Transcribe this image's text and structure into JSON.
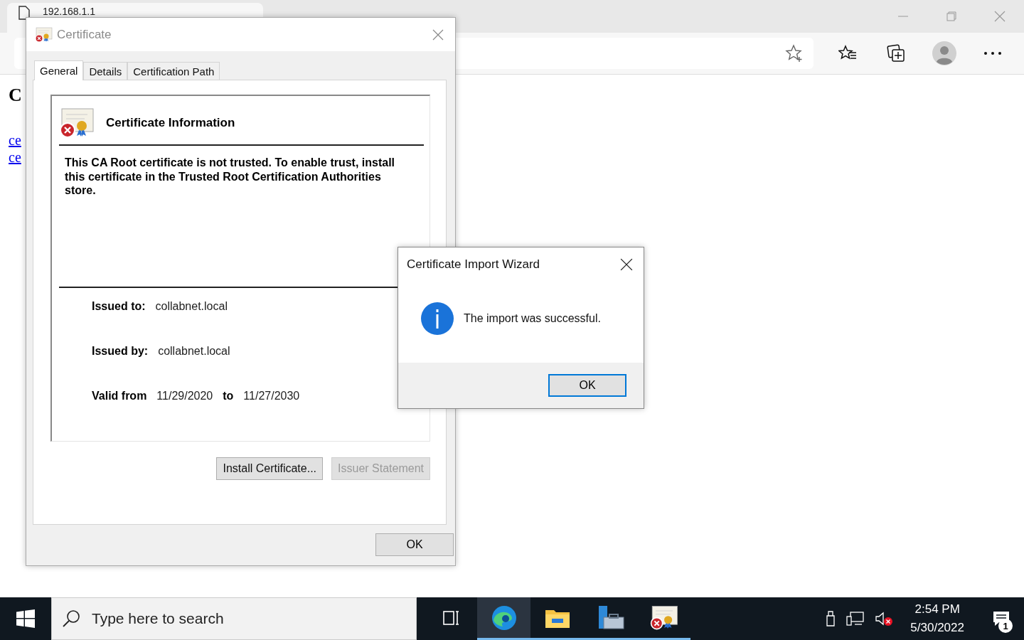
{
  "browser": {
    "tab": {
      "title": "192.168.1.1"
    },
    "page": {
      "heading": "C",
      "links": [
        "ce",
        "ce"
      ]
    }
  },
  "certificate_dialog": {
    "title": "Certificate",
    "tabs": [
      {
        "label": "General",
        "selected": true
      },
      {
        "label": "Details",
        "selected": false
      },
      {
        "label": "Certification Path",
        "selected": false
      }
    ],
    "info_title": "Certificate Information",
    "message": "This CA Root certificate is not trusted. To enable trust, install this certificate in the Trusted Root Certification Authorities store.",
    "fields": [
      {
        "label": "Issued to:",
        "value": "collabnet.local"
      },
      {
        "label": "Issued by:",
        "value": "collabnet.local"
      }
    ],
    "validity": {
      "label": "Valid from",
      "from": "11/29/2020",
      "to_label": "to",
      "to": "11/27/2030"
    },
    "buttons": [
      {
        "label": "Install Certificate...",
        "disabled": false
      },
      {
        "label": "Issuer Statement",
        "disabled": true
      }
    ],
    "ok": "OK"
  },
  "wizard_dialog": {
    "title": "Certificate Import Wizard",
    "message": "The import was successful.",
    "ok": "OK"
  },
  "taskbar": {
    "search_placeholder": "Type here to search",
    "apps": [
      {
        "kind": "taskview",
        "selected": false
      },
      {
        "kind": "edge",
        "selected": true
      },
      {
        "kind": "explorer",
        "selected": false
      },
      {
        "kind": "server",
        "selected": false
      },
      {
        "kind": "certificate",
        "selected": false
      }
    ],
    "time": "2:54 PM",
    "date": "5/30/2022",
    "notification_count": "1"
  }
}
